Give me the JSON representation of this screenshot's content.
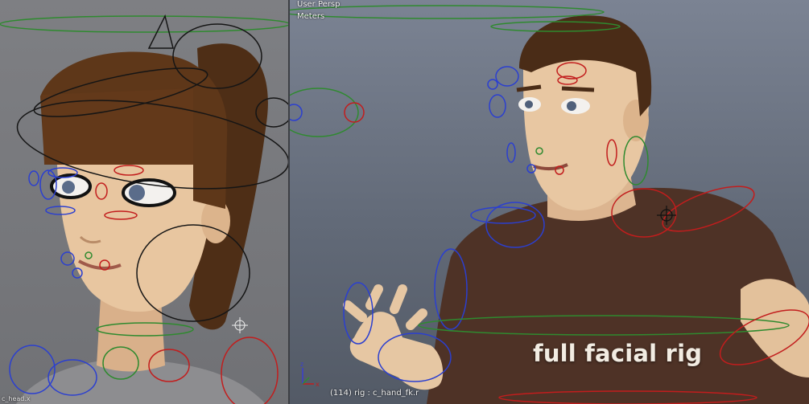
{
  "left_viewport": {
    "status_text": "c_head.x"
  },
  "right_viewport": {
    "view_name": "User Persp",
    "units": "Meters",
    "status_line": "(114) rig : c_hand_fk.r",
    "caption": "full facial rig"
  },
  "colors": {
    "control_blue": "#2b3fd0",
    "control_red": "#c21d1d",
    "control_green": "#2f8a2f",
    "control_black": "#151515",
    "shirt_brown": "#4e3226",
    "skin": "#e6c7a3",
    "hair_brown": "#5a3519"
  },
  "icons": [
    "axis-gizmo-icon",
    "crosshair-cursor-icon"
  ]
}
